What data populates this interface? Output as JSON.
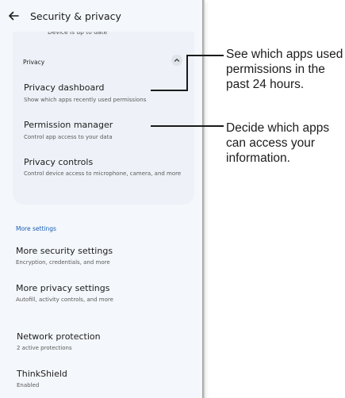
{
  "header": {
    "title": "Security & privacy",
    "back_icon": "arrow-left-icon"
  },
  "card": {
    "top_text": "Device is up to date",
    "section_label": "Privacy",
    "collapse_icon": "chevron-up-icon",
    "items": [
      {
        "title": "Privacy dashboard",
        "subtitle": "Show which apps recently used permissions"
      },
      {
        "title": "Permission manager",
        "subtitle": "Control app access to your data"
      },
      {
        "title": "Privacy controls",
        "subtitle": "Control device access to microphone, camera, and more"
      }
    ]
  },
  "more_settings": {
    "label": "More settings",
    "label_color": "#1a5fb4",
    "items": [
      {
        "title": "More security settings",
        "subtitle": "Encryption, credentials, and more"
      },
      {
        "title": "More privacy settings",
        "subtitle": "Autofill, activity controls, and more"
      },
      {
        "title": "Network protection",
        "subtitle": "2 active protections"
      },
      {
        "title": "ThinkShield",
        "subtitle": "Enabled"
      }
    ]
  },
  "callouts": [
    {
      "text": "See which apps used\npermissions in the\npast 24 hours."
    },
    {
      "text": "Decide which apps\ncan access your\ninformation."
    }
  ]
}
